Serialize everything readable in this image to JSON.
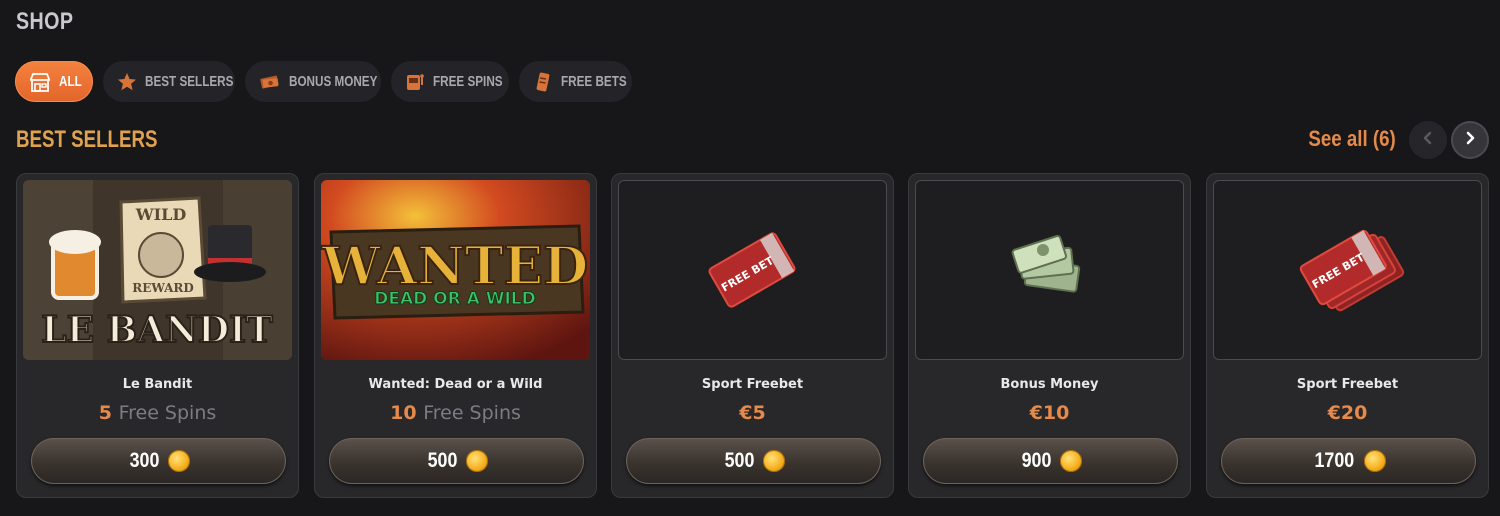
{
  "page": {
    "title": "SHOP"
  },
  "filters": [
    {
      "label": "ALL",
      "icon": "shop-icon",
      "active": true
    },
    {
      "label": "BEST SELLERS",
      "icon": "star-icon",
      "active": false
    },
    {
      "label": "BONUS MONEY",
      "icon": "money-icon",
      "active": false
    },
    {
      "label": "FREE SPINS",
      "icon": "slot-machine-icon",
      "active": false
    },
    {
      "label": "FREE BETS",
      "icon": "ticket-icon",
      "active": false
    }
  ],
  "section": {
    "title": "BEST SELLERS",
    "see_all": "See all (6)"
  },
  "cards": [
    {
      "name": "Le Bandit",
      "amount": "5",
      "unit": "Free Spins",
      "price": "300",
      "art": "le-bandit-game-art",
      "art_text": [
        "WILD",
        "REWARD",
        "LE BANDIT"
      ]
    },
    {
      "name": "Wanted: Dead or a Wild",
      "amount": "10",
      "unit": "Free Spins",
      "price": "500",
      "art": "wanted-dead-or-a-wild-game-art",
      "art_text": [
        "WANTED",
        "DEAD OR A WILD"
      ]
    },
    {
      "name": "Sport Freebet",
      "amount": "€5",
      "unit": "",
      "price": "500",
      "art": "free-bet-ticket-icon",
      "art_text": [
        "FREE BET"
      ]
    },
    {
      "name": "Bonus Money",
      "amount": "€10",
      "unit": "",
      "price": "900",
      "art": "cash-stack-icon",
      "art_text": []
    },
    {
      "name": "Sport Freebet",
      "amount": "€20",
      "unit": "",
      "price": "1700",
      "art": "free-bet-tickets-stack-icon",
      "art_text": [
        "FREE BET"
      ]
    }
  ],
  "colors": {
    "accent": "#e58a4a",
    "section_title": "#e0a24f",
    "background": "#171719",
    "card": "#28282b"
  }
}
